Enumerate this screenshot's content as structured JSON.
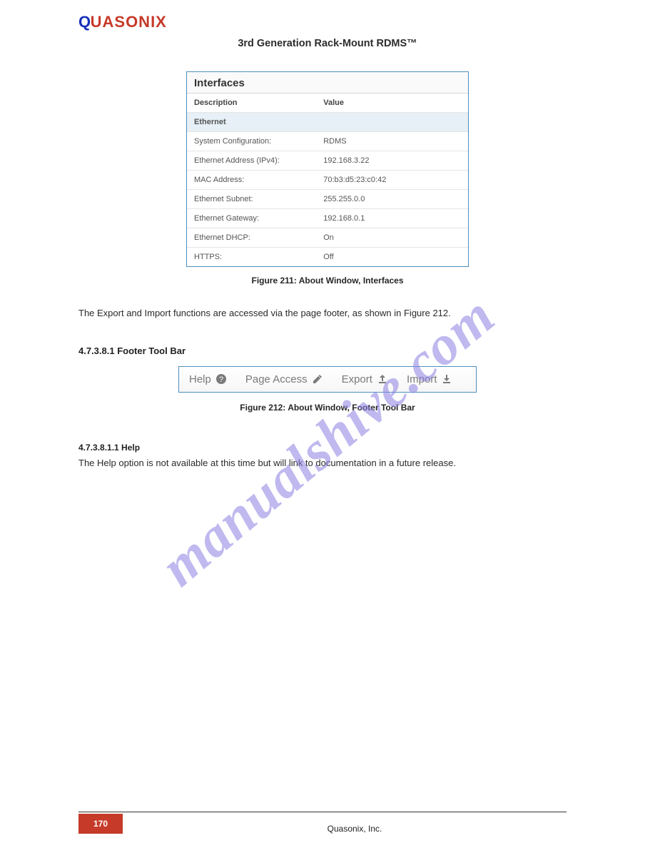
{
  "brand": {
    "q": "Q",
    "rest": "UASONIX"
  },
  "doc_title_l1": "3rd Generation Rack-Mount RDMS™",
  "interfaces": {
    "title": "Interfaces",
    "col1": "Description",
    "col2": "Value",
    "subhead": "Ethernet",
    "rows": [
      {
        "k": "System Configuration:",
        "v": "RDMS"
      },
      {
        "k": "Ethernet Address (IPv4):",
        "v": "192.168.3.22"
      },
      {
        "k": "MAC Address:",
        "v": "70:b3:d5:23:c0:42"
      },
      {
        "k": "Ethernet Subnet:",
        "v": "255.255.0.0"
      },
      {
        "k": "Ethernet Gateway:",
        "v": "192.168.0.1"
      },
      {
        "k": "Ethernet DHCP:",
        "v": "On"
      },
      {
        "k": "HTTPS:",
        "v": "Off"
      }
    ]
  },
  "fig1_cap": "Figure 211: About Window, Interfaces",
  "after_fig1": "The Export and Import functions are accessed via the page footer, as shown in Figure 212.",
  "h3": "4.7.3.8.1 Footer Tool Bar",
  "footerbar": {
    "help": "Help",
    "page_access": "Page Access",
    "export": "Export",
    "import": "Import"
  },
  "fig2_cap": "Figure 212: About Window, Footer Tool Bar",
  "section": "4.7.3.8.1.1 Help",
  "section_body": "The Help option is not available at this time but will link to documentation in a future release.",
  "page_num": "170",
  "footer_text": "Quasonix, Inc.",
  "watermark": "manualshive.com"
}
